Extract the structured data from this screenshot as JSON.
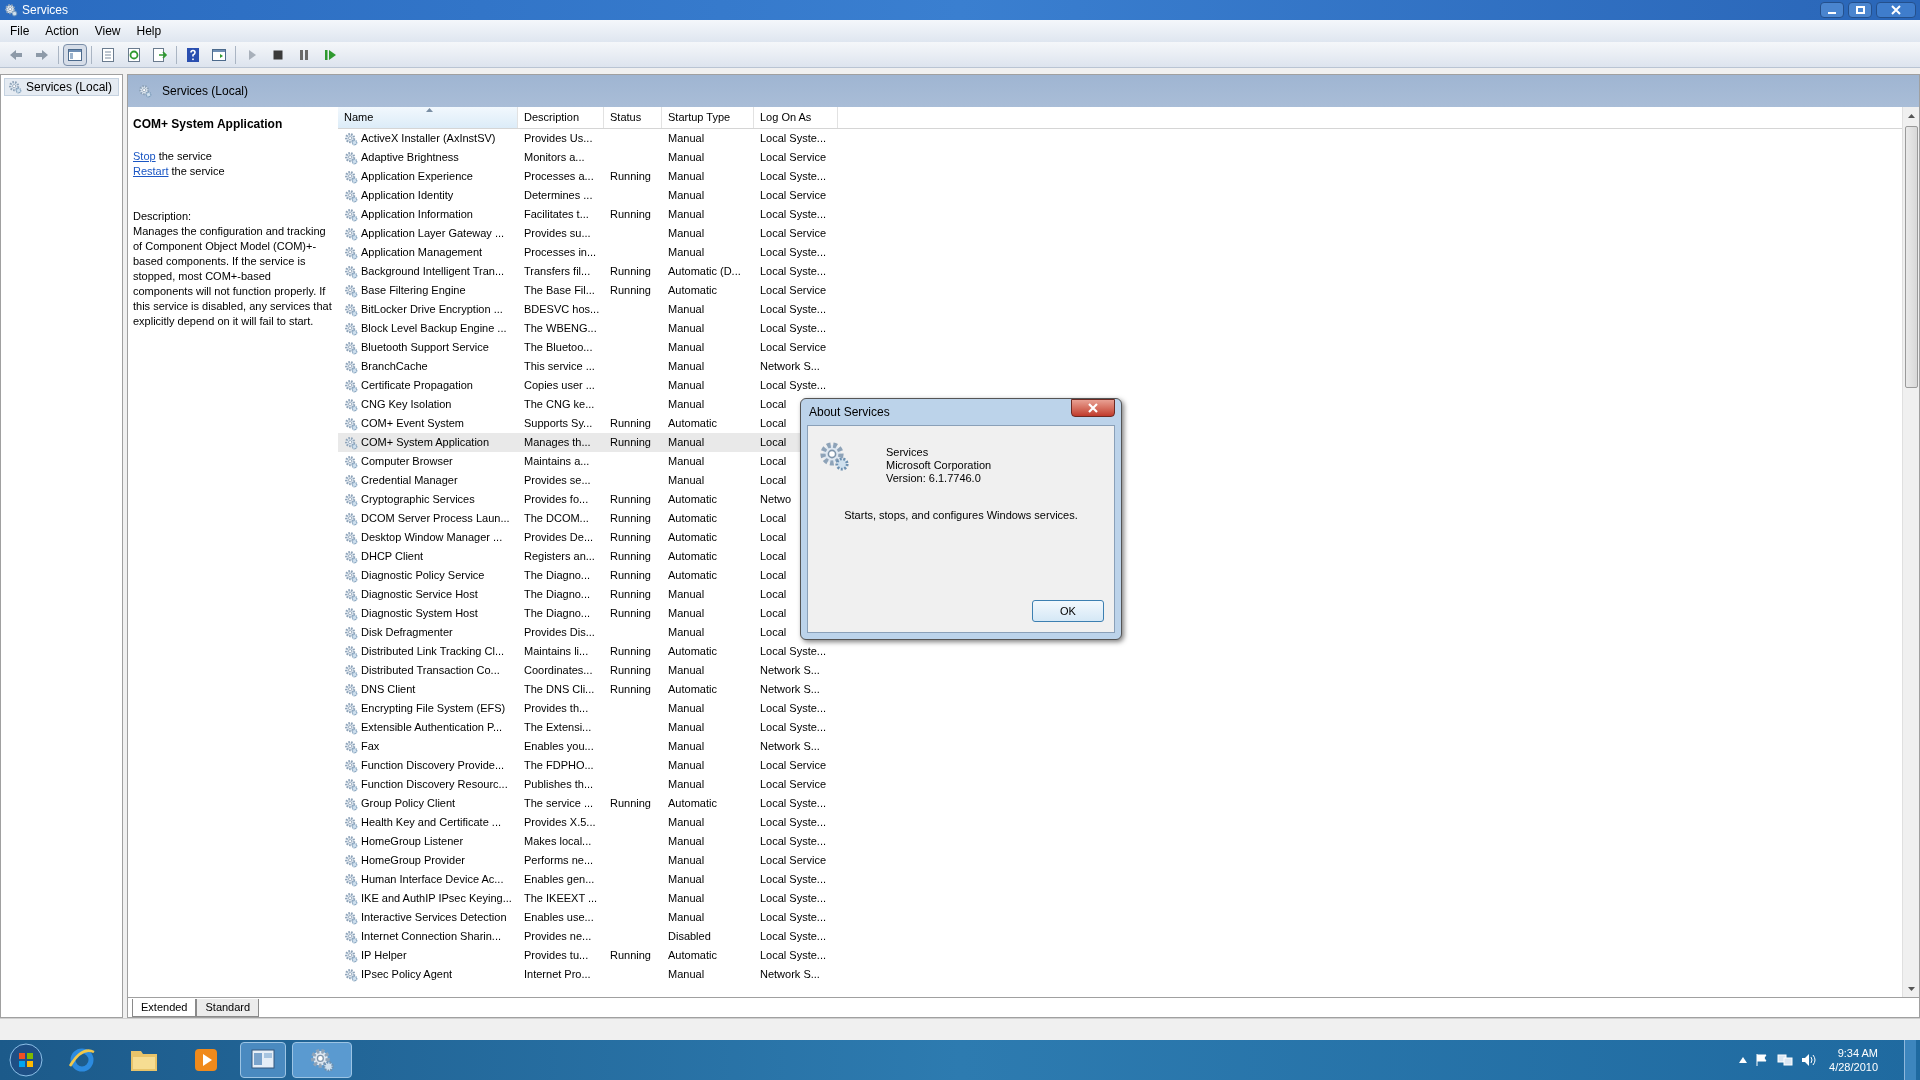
{
  "window": {
    "title": "Services"
  },
  "menu": [
    "File",
    "Action",
    "View",
    "Help"
  ],
  "tree": [
    {
      "label": "Services (Local)",
      "selected": true
    }
  ],
  "panel": {
    "title": "Services (Local)"
  },
  "details": {
    "title": "COM+ System Application",
    "actions": [
      {
        "link": "Stop",
        "rest": "the service"
      },
      {
        "link": "Restart",
        "rest": "the service"
      }
    ],
    "description_label": "Description:",
    "description": "Manages the configuration and tracking of Component Object Model (COM)+-based components. If the service is stopped, most COM+-based components will not function properly. If this service is disabled, any services that explicitly depend on it will fail to start."
  },
  "table": {
    "columns": [
      "Name",
      "Description",
      "Status",
      "Startup Type",
      "Log On As"
    ],
    "rows": [
      {
        "name": "ActiveX Installer (AxInstSV)",
        "description": "Provides Us...",
        "startup_type": "Manual",
        "log_on_as": "Local Syste...",
        "selected": false
      },
      {
        "name": "Adaptive Brightness",
        "description": "Monitors a...",
        "startup_type": "Manual",
        "log_on_as": "Local Service",
        "selected": false
      },
      {
        "name": "Application Experience",
        "description": "Processes a...",
        "status": "Running",
        "startup_type": "Manual",
        "log_on_as": "Local Syste...",
        "selected": false
      },
      {
        "name": "Application Identity",
        "description": "Determines ...",
        "startup_type": "Manual",
        "log_on_as": "Local Service",
        "selected": false
      },
      {
        "name": "Application Information",
        "description": "Facilitates t...",
        "status": "Running",
        "startup_type": "Manual",
        "log_on_as": "Local Syste...",
        "selected": false
      },
      {
        "name": "Application Layer Gateway ...",
        "description": "Provides su...",
        "startup_type": "Manual",
        "log_on_as": "Local Service",
        "selected": false
      },
      {
        "name": "Application Management",
        "description": "Processes in...",
        "startup_type": "Manual",
        "log_on_as": "Local Syste...",
        "selected": false
      },
      {
        "name": "Background Intelligent Tran...",
        "description": "Transfers fil...",
        "status": "Running",
        "startup_type": "Automatic (D...",
        "log_on_as": "Local Syste...",
        "selected": false
      },
      {
        "name": "Base Filtering Engine",
        "description": "The Base Fil...",
        "status": "Running",
        "startup_type": "Automatic",
        "log_on_as": "Local Service",
        "selected": false
      },
      {
        "name": "BitLocker Drive Encryption ...",
        "description": "BDESVC hos...",
        "startup_type": "Manual",
        "log_on_as": "Local Syste...",
        "selected": false
      },
      {
        "name": "Block Level Backup Engine ...",
        "description": "The WBENG...",
        "startup_type": "Manual",
        "log_on_as": "Local Syste...",
        "selected": false
      },
      {
        "name": "Bluetooth Support Service",
        "description": "The Bluetoo...",
        "startup_type": "Manual",
        "log_on_as": "Local Service",
        "selected": false
      },
      {
        "name": "BranchCache",
        "description": "This service ...",
        "startup_type": "Manual",
        "log_on_as": "Network S...",
        "selected": false
      },
      {
        "name": "Certificate Propagation",
        "description": "Copies user ...",
        "startup_type": "Manual",
        "log_on_as": "Local Syste...",
        "selected": false
      },
      {
        "name": "CNG Key Isolation",
        "description": "The CNG ke...",
        "startup_type": "Manual",
        "log_on_as": "Local",
        "selected": false
      },
      {
        "name": "COM+ Event System",
        "description": "Supports Sy...",
        "status": "Running",
        "startup_type": "Automatic",
        "log_on_as": "Local",
        "selected": false
      },
      {
        "name": "COM+ System Application",
        "description": "Manages th...",
        "status": "Running",
        "startup_type": "Manual",
        "log_on_as": "Local",
        "selected": true
      },
      {
        "name": "Computer Browser",
        "description": "Maintains a...",
        "startup_type": "Manual",
        "log_on_as": "Local",
        "selected": false
      },
      {
        "name": "Credential Manager",
        "description": "Provides se...",
        "startup_type": "Manual",
        "log_on_as": "Local",
        "selected": false
      },
      {
        "name": "Cryptographic Services",
        "description": "Provides fo...",
        "status": "Running",
        "startup_type": "Automatic",
        "log_on_as": "Netwo",
        "selected": false
      },
      {
        "name": "DCOM Server Process Laun...",
        "description": "The DCOM...",
        "status": "Running",
        "startup_type": "Automatic",
        "log_on_as": "Local",
        "selected": false
      },
      {
        "name": "Desktop Window Manager ...",
        "description": "Provides De...",
        "status": "Running",
        "startup_type": "Automatic",
        "log_on_as": "Local",
        "selected": false
      },
      {
        "name": "DHCP Client",
        "description": "Registers an...",
        "status": "Running",
        "startup_type": "Automatic",
        "log_on_as": "Local",
        "selected": false
      },
      {
        "name": "Diagnostic Policy Service",
        "description": "The Diagno...",
        "status": "Running",
        "startup_type": "Automatic",
        "log_on_as": "Local",
        "selected": false
      },
      {
        "name": "Diagnostic Service Host",
        "description": "The Diagno...",
        "status": "Running",
        "startup_type": "Manual",
        "log_on_as": "Local",
        "selected": false
      },
      {
        "name": "Diagnostic System Host",
        "description": "The Diagno...",
        "status": "Running",
        "startup_type": "Manual",
        "log_on_as": "Local",
        "selected": false
      },
      {
        "name": "Disk Defragmenter",
        "description": "Provides Dis...",
        "startup_type": "Manual",
        "log_on_as": "Local",
        "selected": false
      },
      {
        "name": "Distributed Link Tracking Cl...",
        "description": "Maintains li...",
        "status": "Running",
        "startup_type": "Automatic",
        "log_on_as": "Local Syste...",
        "selected": false
      },
      {
        "name": "Distributed Transaction Co...",
        "description": "Coordinates...",
        "status": "Running",
        "startup_type": "Manual",
        "log_on_as": "Network S...",
        "selected": false
      },
      {
        "name": "DNS Client",
        "description": "The DNS Cli...",
        "status": "Running",
        "startup_type": "Automatic",
        "log_on_as": "Network S...",
        "selected": false
      },
      {
        "name": "Encrypting File System (EFS)",
        "description": "Provides th...",
        "startup_type": "Manual",
        "log_on_as": "Local Syste...",
        "selected": false
      },
      {
        "name": "Extensible Authentication P...",
        "description": "The Extensi...",
        "startup_type": "Manual",
        "log_on_as": "Local Syste...",
        "selected": false
      },
      {
        "name": "Fax",
        "description": "Enables you...",
        "startup_type": "Manual",
        "log_on_as": "Network S...",
        "selected": false
      },
      {
        "name": "Function Discovery Provide...",
        "description": "The FDPHO...",
        "startup_type": "Manual",
        "log_on_as": "Local Service",
        "selected": false
      },
      {
        "name": "Function Discovery Resourc...",
        "description": "Publishes th...",
        "startup_type": "Manual",
        "log_on_as": "Local Service",
        "selected": false
      },
      {
        "name": "Group Policy Client",
        "description": "The service ...",
        "status": "Running",
        "startup_type": "Automatic",
        "log_on_as": "Local Syste...",
        "selected": false
      },
      {
        "name": "Health Key and Certificate ...",
        "description": "Provides X.5...",
        "startup_type": "Manual",
        "log_on_as": "Local Syste...",
        "selected": false
      },
      {
        "name": "HomeGroup Listener",
        "description": "Makes local...",
        "startup_type": "Manual",
        "log_on_as": "Local Syste...",
        "selected": false
      },
      {
        "name": "HomeGroup Provider",
        "description": "Performs ne...",
        "startup_type": "Manual",
        "log_on_as": "Local Service",
        "selected": false
      },
      {
        "name": "Human Interface Device Ac...",
        "description": "Enables gen...",
        "startup_type": "Manual",
        "log_on_as": "Local Syste...",
        "selected": false
      },
      {
        "name": "IKE and AuthIP IPsec Keying...",
        "description": "The IKEEXT ...",
        "startup_type": "Manual",
        "log_on_as": "Local Syste...",
        "selected": false
      },
      {
        "name": "Interactive Services Detection",
        "description": "Enables use...",
        "startup_type": "Manual",
        "log_on_as": "Local Syste...",
        "selected": false
      },
      {
        "name": "Internet Connection Sharin...",
        "description": "Provides ne...",
        "startup_type": "Disabled",
        "log_on_as": "Local Syste...",
        "selected": false
      },
      {
        "name": "IP Helper",
        "description": "Provides tu...",
        "status": "Running",
        "startup_type": "Automatic",
        "log_on_as": "Local Syste...",
        "selected": false
      },
      {
        "name": "IPsec Policy Agent",
        "description": "Internet Pro...",
        "startup_type": "Manual",
        "log_on_as": "Network S...",
        "selected": false
      }
    ]
  },
  "tabs": [
    {
      "label": "Extended",
      "selected": true
    },
    {
      "label": "Standard",
      "selected": false
    }
  ],
  "dialog": {
    "title": "About Services",
    "lines": [
      "Services",
      "Microsoft Corporation",
      "Version: 6.1.7746.0"
    ],
    "message": "Starts, stops, and configures Windows services.",
    "button": "OK"
  },
  "taskbar": {
    "time": "9:34 AM",
    "date": "4/28/2010"
  }
}
